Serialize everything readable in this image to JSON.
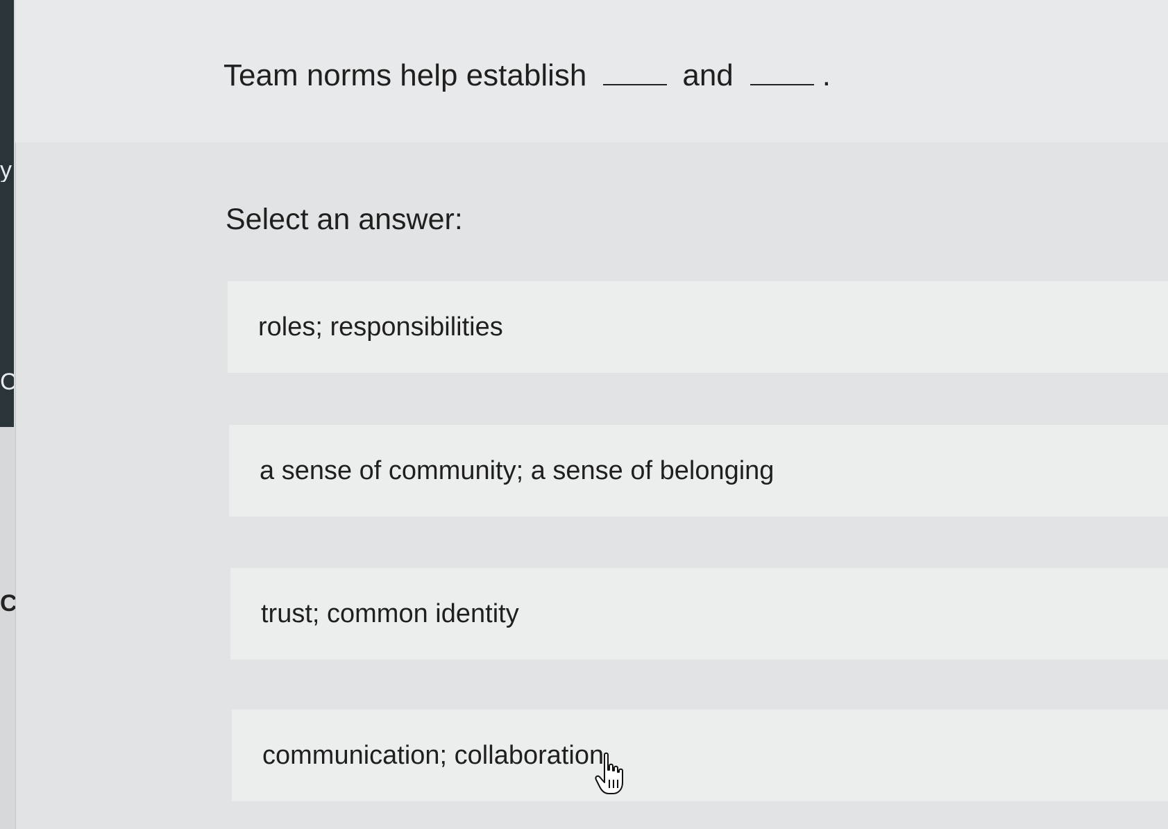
{
  "sidebar": {
    "glyphs": [
      "y",
      "C",
      "C"
    ]
  },
  "question": {
    "prefix": "Team norms help establish",
    "middle": "and",
    "suffix": "."
  },
  "prompt": "Select an answer:",
  "options": [
    {
      "label": "roles; responsibilities"
    },
    {
      "label": "a sense of community; a sense of belonging"
    },
    {
      "label": "trust; common identity"
    },
    {
      "label": "communication; collaboration"
    }
  ],
  "cursor": {
    "icon": "hand-pointer-icon"
  }
}
